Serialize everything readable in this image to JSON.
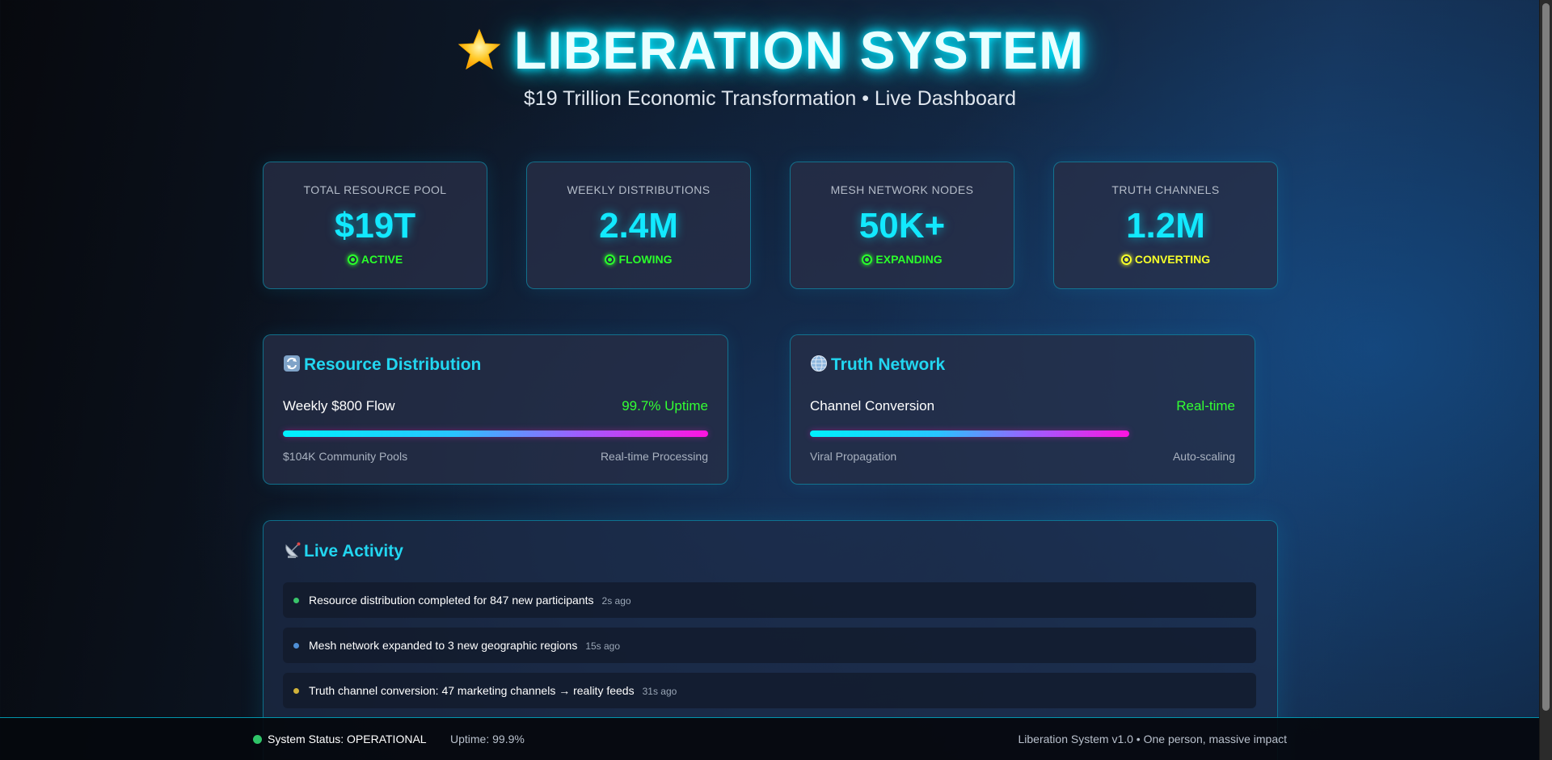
{
  "header": {
    "title": "LIBERATION SYSTEM",
    "subtitle": "$19 Trillion Economic Transformation • Live Dashboard",
    "icon": "glowing-star-icon"
  },
  "stats": [
    {
      "label": "TOTAL RESOURCE POOL",
      "value": "$19T",
      "status": "ACTIVE",
      "status_color": "#2bff2b"
    },
    {
      "label": "WEEKLY DISTRIBUTIONS",
      "value": "2.4M",
      "status": "FLOWING",
      "status_color": "#2bff2b"
    },
    {
      "label": "MESH NETWORK NODES",
      "value": "50K+",
      "status": "EXPANDING",
      "status_color": "#2bff2b"
    },
    {
      "label": "TRUTH CHANNELS",
      "value": "1.2M",
      "status": "CONVERTING",
      "status_color": "#f7ff2a"
    }
  ],
  "panels": [
    {
      "title": "Resource Distribution",
      "icon": "refresh-arrows-icon",
      "metric_label": "Weekly $800 Flow",
      "metric_value": "99.7% Uptime",
      "progress": 1.0,
      "footer_left": "$104K Community Pools",
      "footer_right": "Real-time Processing"
    },
    {
      "title": "Truth Network",
      "icon": "globe-icon",
      "metric_label": "Channel Conversion",
      "metric_value": "Real-time",
      "progress": 0.75,
      "footer_left": "Viral Propagation",
      "footer_right": "Auto-scaling"
    }
  ],
  "activity": {
    "title": "Live Activity",
    "icon": "satellite-antenna-icon",
    "items": [
      {
        "message": "Resource distribution completed for 847 new participants",
        "time": "2s ago",
        "color": "#39c46a"
      },
      {
        "message": "Mesh network expanded to 3 new geographic regions",
        "time": "15s ago",
        "color": "#4f8fd6"
      },
      {
        "message": "Truth channel conversion: 47 marketing channels → reality feeds",
        "time": "31s ago",
        "color": "#d1b23a"
      }
    ]
  },
  "footer": {
    "status": "System Status: OPERATIONAL",
    "uptime": "Uptime: 99.9%",
    "version": "Liberation System v1.0 • One person, massive impact",
    "status_color": "#2fc468"
  }
}
